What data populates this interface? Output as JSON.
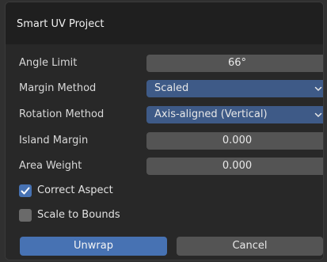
{
  "dialog": {
    "title": "Smart UV Project",
    "angle_limit": {
      "label": "Angle Limit",
      "value": "66°"
    },
    "margin_method": {
      "label": "Margin Method",
      "selected": "Scaled"
    },
    "rotation_method": {
      "label": "Rotation Method",
      "selected": "Axis-aligned (Vertical)"
    },
    "island_margin": {
      "label": "Island Margin",
      "value": "0.000"
    },
    "area_weight": {
      "label": "Area Weight",
      "value": "0.000"
    },
    "correct_aspect": {
      "label": "Correct Aspect",
      "checked": true
    },
    "scale_to_bounds": {
      "label": "Scale to Bounds",
      "checked": false
    },
    "unwrap_button": "Unwrap",
    "cancel_button": "Cancel"
  },
  "colors": {
    "accent": "#4772b3",
    "select_bg": "#3e5a87",
    "field_bg": "#545454",
    "panel_bg": "#282828"
  }
}
